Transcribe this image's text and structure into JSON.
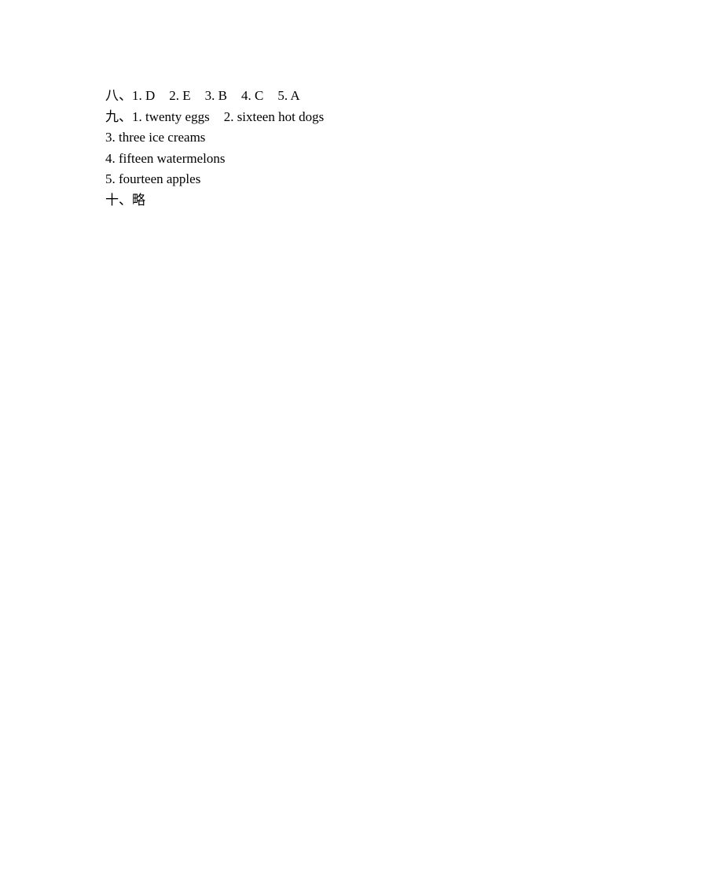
{
  "sections": [
    {
      "marker": "八、",
      "items": [
        "1. D",
        "2. E",
        "3. B",
        "4. C",
        "5. A"
      ]
    },
    {
      "marker": "九、",
      "items": [
        "1. twenty eggs",
        "2. sixteen hot dogs"
      ],
      "continuation": [
        "3. three ice creams",
        "4. fifteen watermelons",
        "5. fourteen apples"
      ]
    },
    {
      "marker": "十、",
      "text": "略"
    }
  ]
}
